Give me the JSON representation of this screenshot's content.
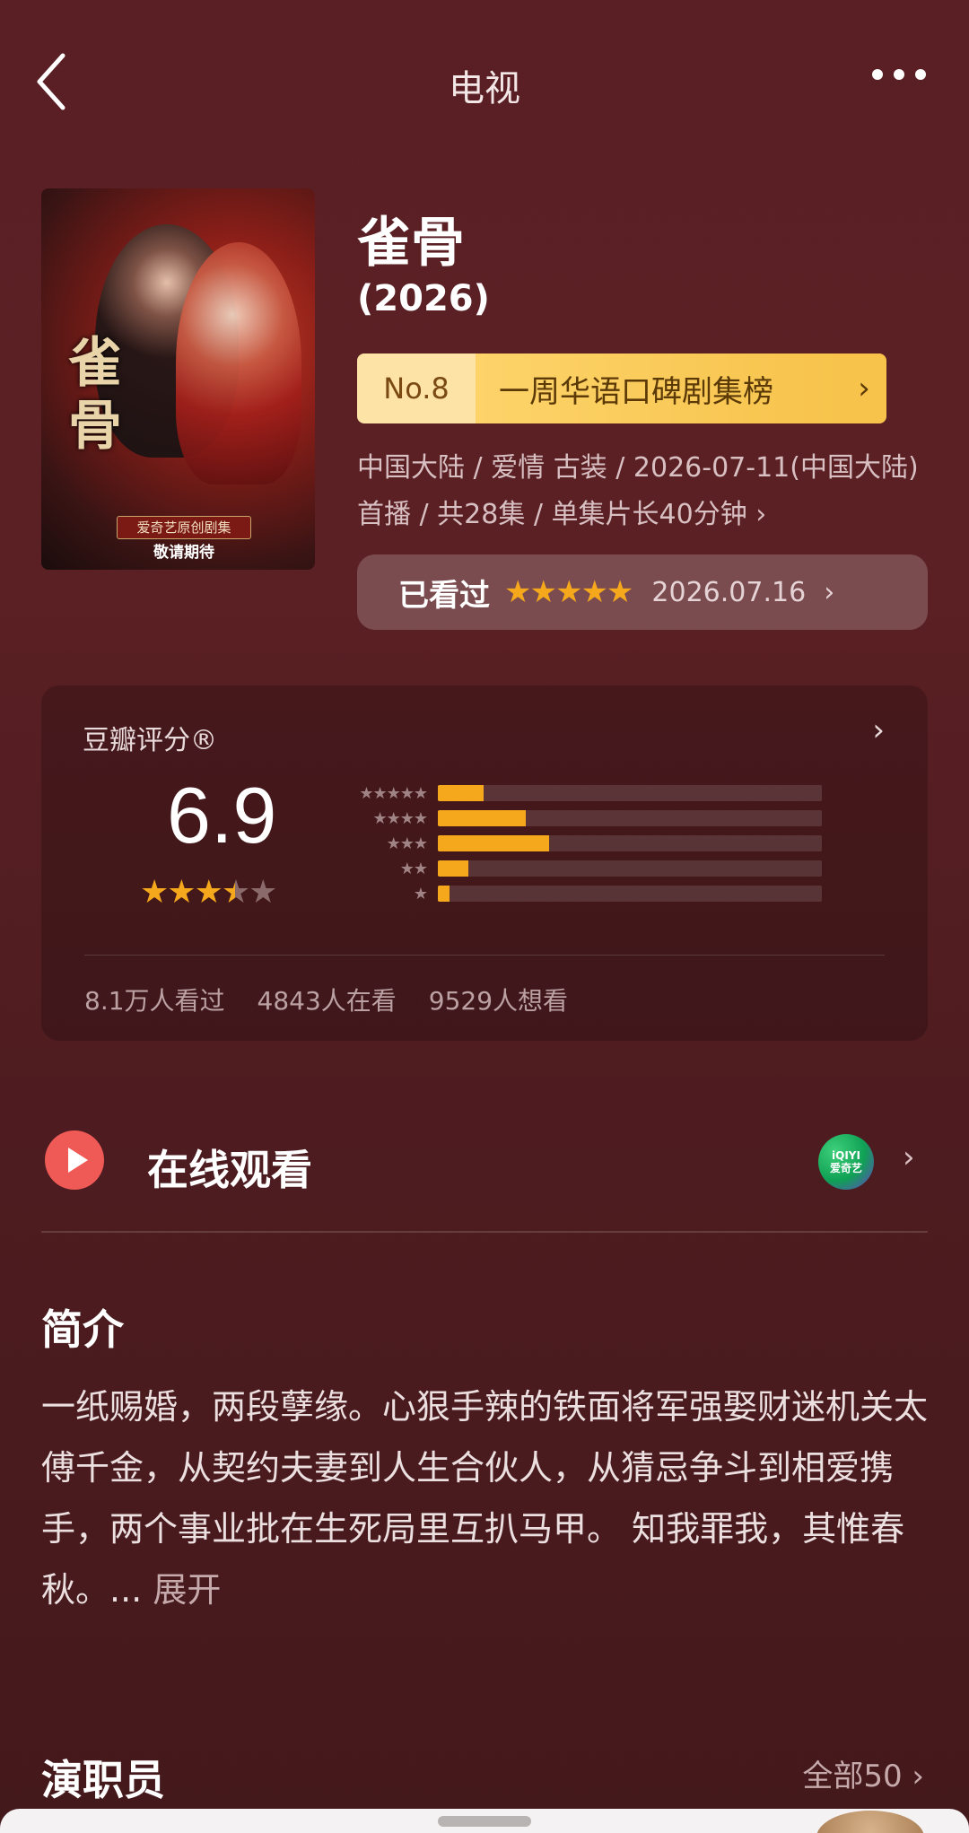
{
  "header": {
    "title": "电视"
  },
  "poster": {
    "calligraphy": "雀骨",
    "tag_top": "爱奇艺原创剧集",
    "tag_bottom": "敬请期待"
  },
  "movie": {
    "title": "雀骨",
    "year": "(2026)",
    "rank_no": "No.8",
    "rank_name": "一周华语口碑剧集榜",
    "meta": "中国大陆 / 爱情 古装 / 2026-07-11(中国大陆)首播 / 共28集 / 单集片长40分钟 ›"
  },
  "watched": {
    "label": "已看过",
    "stars": "★★★★★",
    "date": "2026.07.16"
  },
  "rating": {
    "title": "豆瓣评分®",
    "score": "6.9",
    "stars_value": 3.5,
    "distribution": [
      {
        "stars": "★★★★★",
        "fraction": 0.12
      },
      {
        "stars": "★★★★",
        "fraction": 0.23
      },
      {
        "stars": "★★★",
        "fraction": 0.29
      },
      {
        "stars": "★★",
        "fraction": 0.08
      },
      {
        "stars": "★",
        "fraction": 0.03
      }
    ],
    "stats": [
      "8.1万人看过",
      "4843人在看",
      "9529人想看"
    ]
  },
  "watch_online": {
    "label": "在线观看",
    "provider_line1": "iQIYI",
    "provider_line2": "爱奇艺"
  },
  "intro": {
    "title": "简介",
    "text": "一纸赐婚，两段孽缘。心狠手辣的铁面将军强娶财迷机关太傅千金，从契约夫妻到人生合伙人，从猜忌争斗到相爱携手，两个事业批在生死局里互扒马甲。 知我罪我，其惟春秋。... ",
    "more": "展开"
  },
  "cast": {
    "title": "演职员",
    "all_label": "全部50 ›"
  },
  "colors": {
    "accent": "#f6a81c",
    "rank_bg": "#fdd36a",
    "play": "#f05a56"
  }
}
